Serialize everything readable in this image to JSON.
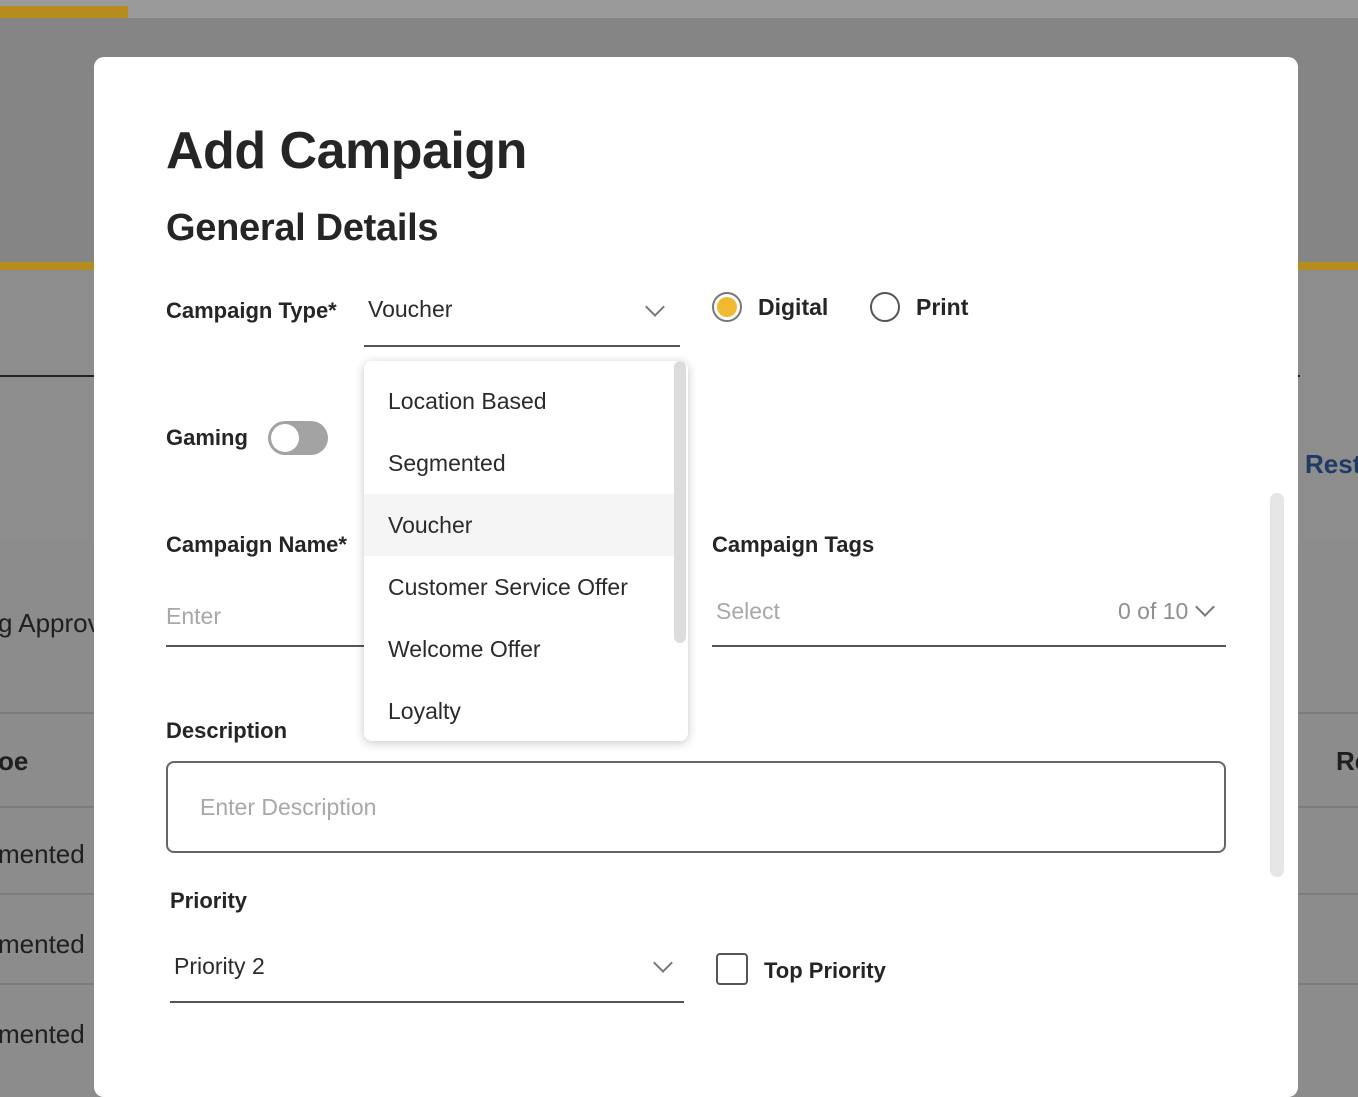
{
  "background": {
    "left_texts": [
      "g Approv",
      "oe",
      "mented",
      "mented",
      "mented"
    ],
    "right_texts": [
      "Rest",
      "Re"
    ]
  },
  "modal": {
    "title": "Add Campaign",
    "section_title": "General Details",
    "campaign_type": {
      "label": "Campaign Type*",
      "value": "Voucher"
    },
    "channel": {
      "options": [
        {
          "label": "Digital",
          "checked": true
        },
        {
          "label": "Print",
          "checked": false
        }
      ]
    },
    "gaming": {
      "label": "Gaming",
      "enabled": false
    },
    "campaign_name": {
      "label": "Campaign Name*",
      "placeholder": "Enter"
    },
    "campaign_tags": {
      "label": "Campaign Tags",
      "placeholder": "Select",
      "count": "0 of 10"
    },
    "description": {
      "label": "Description",
      "placeholder": "Enter Description"
    },
    "priority": {
      "label": "Priority",
      "value": "Priority 2",
      "top_priority_label": "Top Priority",
      "top_priority_checked": false
    },
    "campaign_type_dropdown": {
      "options": [
        "Location Based",
        "Segmented",
        "Voucher",
        "Customer Service Offer",
        "Welcome Offer",
        "Loyalty"
      ],
      "selected": "Voucher"
    }
  },
  "colors": {
    "accent_gold": "#f2b830",
    "backdrop": "#8a8a8a",
    "text_dark": "#252525",
    "placeholder": "#a8a8a8"
  }
}
